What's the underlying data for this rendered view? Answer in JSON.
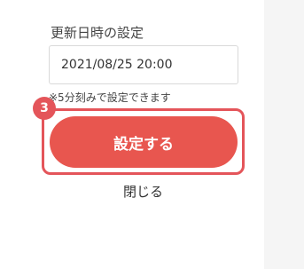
{
  "form": {
    "label": "更新日時の設定",
    "datetime_value": "2021/08/25 20:00",
    "hint": "※5分刻みで設定できます"
  },
  "step_badge": "3",
  "buttons": {
    "submit_label": "設定する",
    "close_label": "閉じる"
  },
  "colors": {
    "accent": "#e8564f",
    "highlight": "#e4555a",
    "sidebar": "#f5f5f5"
  }
}
